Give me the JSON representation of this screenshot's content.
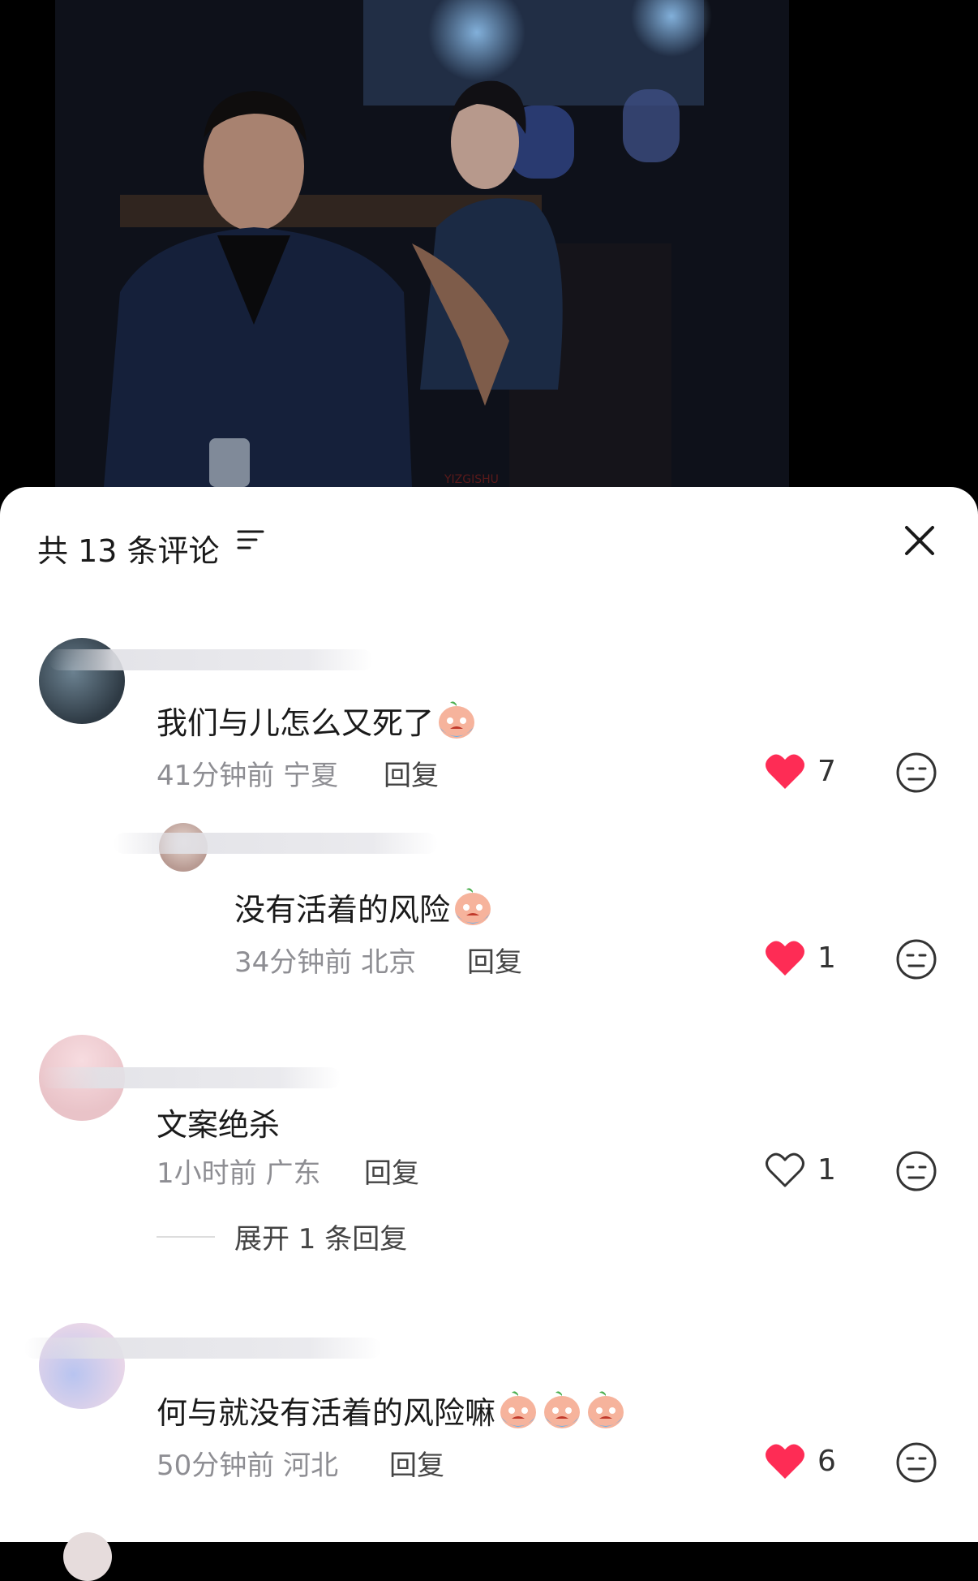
{
  "video": {
    "watermark": "YIZGISHU"
  },
  "header": {
    "title": "共 13 条评论"
  },
  "comments": [
    {
      "text": "我们与儿怎么又死了",
      "time": "41分钟前",
      "region": "宁夏",
      "reply": "回复",
      "likes": "7",
      "liked": true,
      "emoji_count": 1
    },
    {
      "text": "没有活着的风险",
      "time": "34分钟前",
      "region": "北京",
      "reply": "回复",
      "likes": "1",
      "liked": true,
      "emoji_count": 1
    },
    {
      "text": "文案绝杀",
      "time": "1小时前",
      "region": "广东",
      "reply": "回复",
      "likes": "1",
      "liked": false,
      "emoji_count": 0,
      "expand": "展开 1 条回复"
    },
    {
      "text": "何与就没有活着的风险嘛",
      "time": "50分钟前",
      "region": "河北",
      "reply": "回复",
      "likes": "6",
      "liked": true,
      "emoji_count": 3
    }
  ],
  "colors": {
    "liked": "#fe2c55",
    "muted": "#8e8e93",
    "background": "#ffffff"
  }
}
